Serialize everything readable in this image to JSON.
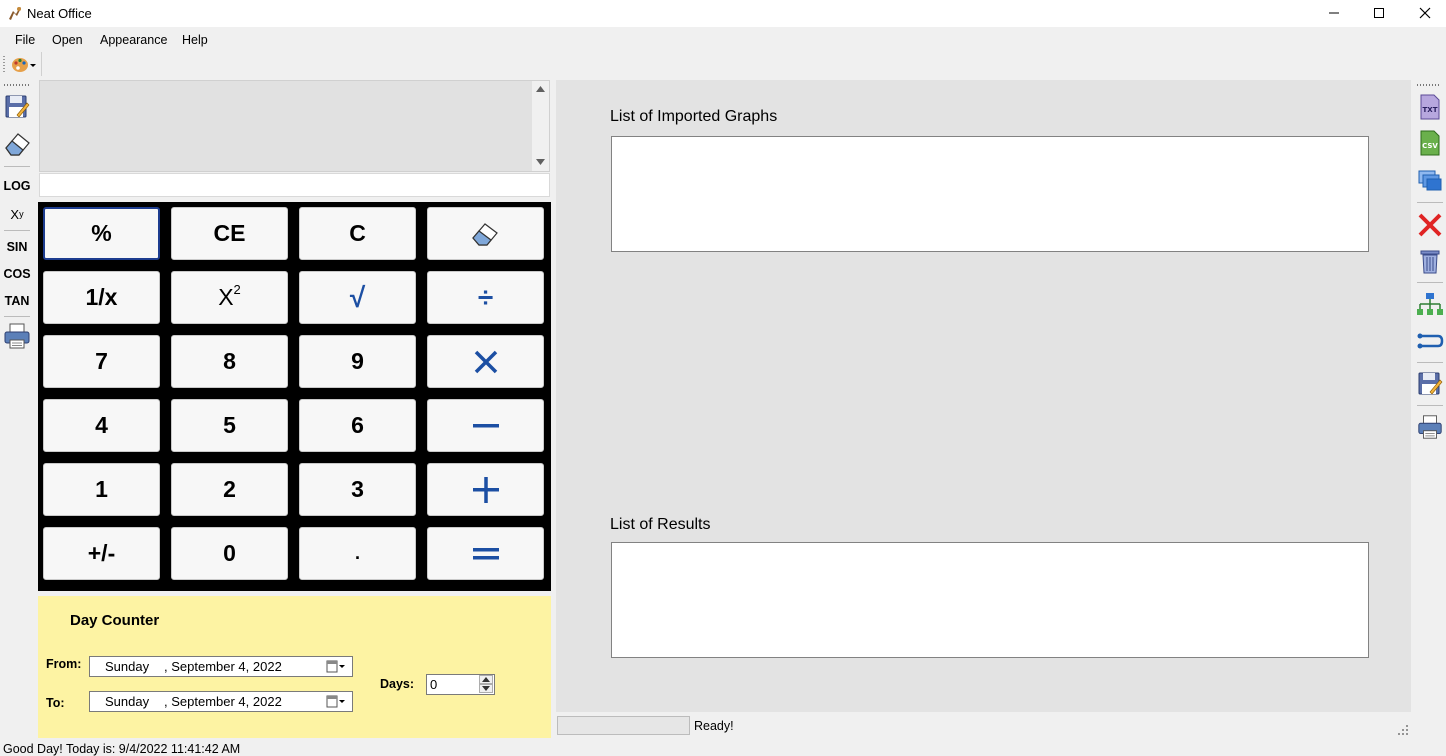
{
  "window": {
    "title": "Neat Office",
    "controls": {
      "minimize": "minimize-icon",
      "maximize": "maximize-icon",
      "close": "close-icon"
    }
  },
  "menu": {
    "items": [
      "File",
      "Open",
      "Appearance",
      "Help"
    ]
  },
  "toolstrip": {
    "palette_icon": "palette-dropdown-icon"
  },
  "left_toolbar": {
    "save_icon": "save-icon",
    "clear_icon": "eraser-icon",
    "log": "LOG",
    "power_base": "X",
    "power_exp": "y",
    "sin": "SIN",
    "cos": "COS",
    "tan": "TAN",
    "print_icon": "print-icon"
  },
  "display": {
    "history": "",
    "entry": ""
  },
  "keypad": {
    "percent": "%",
    "ce": "CE",
    "c": "C",
    "erase_icon": "eraser-icon",
    "reciprocal": "1/x",
    "square_base": "X",
    "square_exp": "2",
    "sqrt": "√",
    "divide": "÷",
    "seven": "7",
    "eight": "8",
    "nine": "9",
    "multiply_icon": "multiply-icon",
    "four": "4",
    "five": "5",
    "six": "6",
    "minus_icon": "minus-icon",
    "one": "1",
    "two": "2",
    "three": "3",
    "plus_icon": "plus-icon",
    "negate": "+/-",
    "zero": "0",
    "decimal": ".",
    "equals_icon": "equals-icon",
    "accent": "#1c4fa3"
  },
  "day_counter": {
    "title": "Day Counter",
    "from_label": "From:",
    "to_label": "To:",
    "from_day": "Sunday",
    "from_date": ", September  4, 2022",
    "to_day": "Sunday",
    "to_date": ", September  4, 2022",
    "days_label": "Days:",
    "days_value": "0",
    "background": "#fdf3a3"
  },
  "right_panel": {
    "graphs_title": "List of Imported Graphs",
    "results_title": "List of Results"
  },
  "right_toolbar": {
    "icons": [
      "txt-file-icon",
      "csv-file-icon",
      "layers-icon",
      "delete-x-icon",
      "trash-icon",
      "tree-icon",
      "link-icon",
      "save-icon",
      "print-icon"
    ]
  },
  "status": {
    "ready": "Ready!",
    "progress": 0.0,
    "bottom_text": "Good Day! Today is: 9/4/2022 11:41:42 AM"
  }
}
